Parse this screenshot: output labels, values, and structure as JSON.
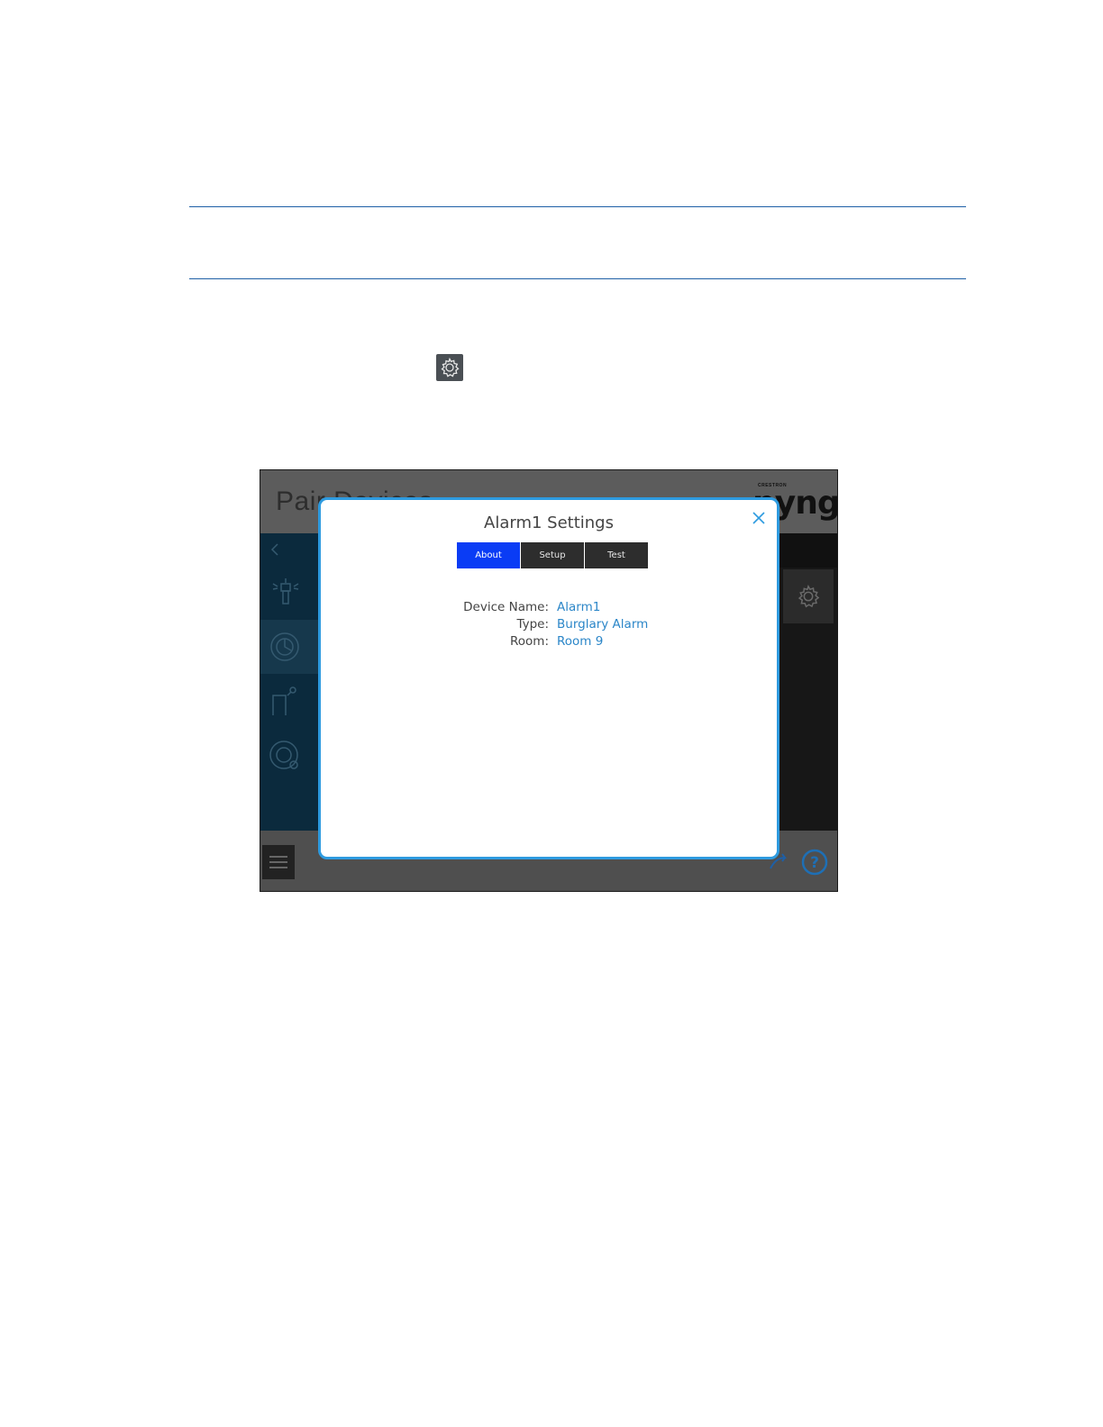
{
  "app": {
    "title": "Pair Devices",
    "brand_small": "CRESTRON",
    "brand_big": "pyng"
  },
  "icons": {
    "gear": "gear-icon",
    "back": "chevron-left-icon",
    "sidebar": [
      "sprinkler-icon",
      "alarm-dial-icon",
      "door-sensor-icon",
      "smoke-detector-icon"
    ],
    "menu": "hamburger-menu-icon",
    "help": "help-icon",
    "share": "share-icon",
    "close": "close-icon"
  },
  "modal": {
    "title": "Alarm1 Settings",
    "tabs": [
      {
        "label": "About",
        "active": true
      },
      {
        "label": "Setup",
        "active": false
      },
      {
        "label": "Test",
        "active": false
      }
    ],
    "rows": [
      {
        "label": "Device Name:",
        "value": "Alarm1"
      },
      {
        "label": "Type:",
        "value": "Burglary Alarm"
      },
      {
        "label": "Room:",
        "value": "Room 9"
      }
    ]
  },
  "colors": {
    "accent": "#2e9be0",
    "active_tab": "#0a3cf5",
    "value_text": "#2b86c8",
    "rule": "#1e5fa6"
  }
}
